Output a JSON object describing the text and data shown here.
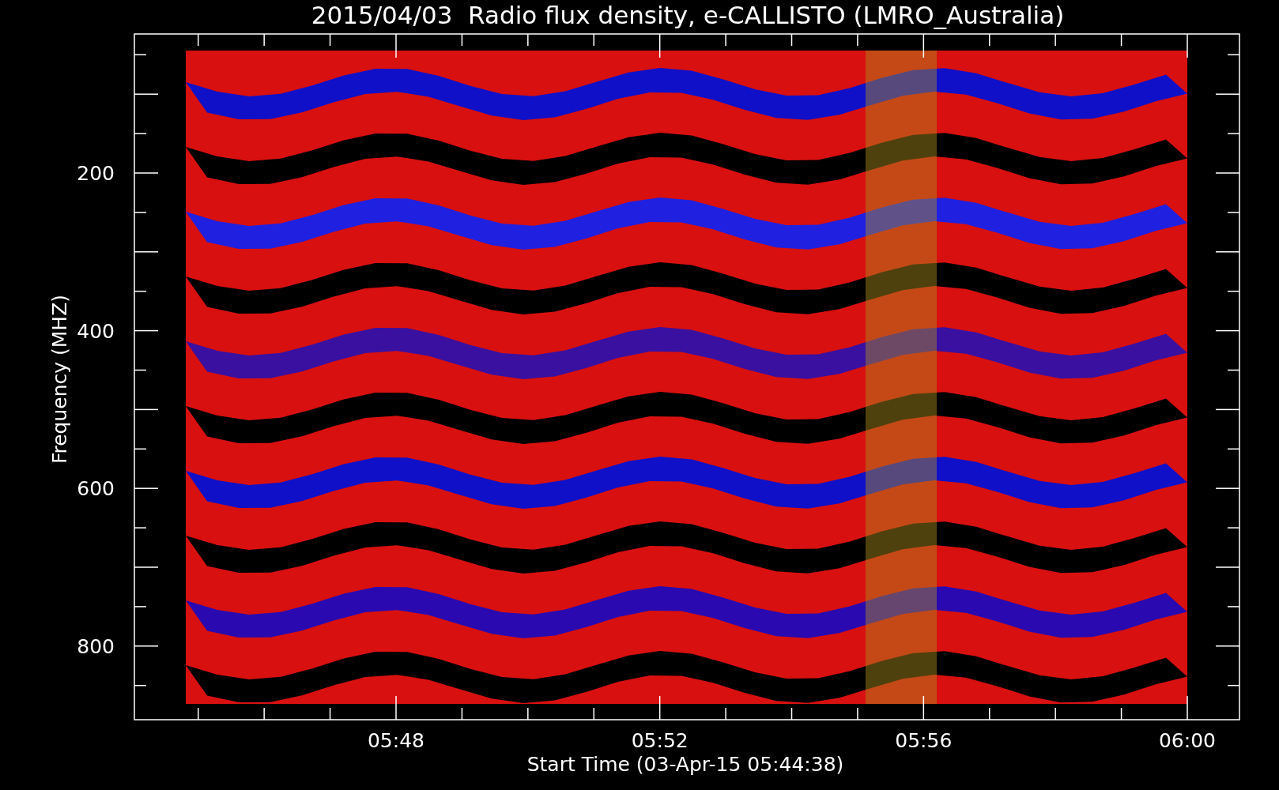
{
  "title": "2015/04/03  Radio flux density, e-CALLISTO (LMRO_Australia)",
  "y_axis": {
    "label": "Frequency (MHZ)",
    "ticks": [
      "200",
      "400",
      "600",
      "800"
    ]
  },
  "x_axis": {
    "label": "Start Time (03-Apr-15 05:44:38)",
    "ticks": [
      "05:48",
      "05:52",
      "05:56",
      "06:00"
    ]
  }
}
